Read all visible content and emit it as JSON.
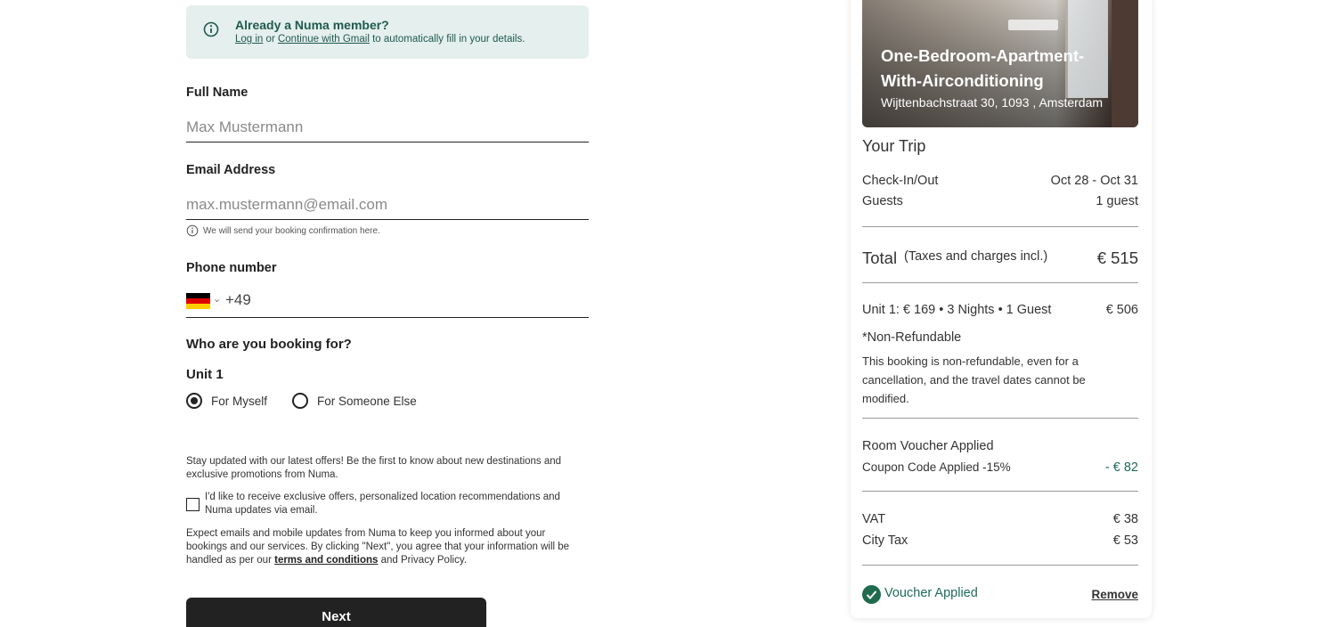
{
  "member_banner": {
    "title": "Already a Numa member?",
    "login_link": "Log in",
    "or_text": "or",
    "gmail_link": "Continue with Gmail",
    "suffix": "to automatically fill in your details."
  },
  "form": {
    "full_name_label": "Full Name",
    "full_name_placeholder": "Max Mustermann",
    "email_label": "Email Address",
    "email_placeholder": "max.mustermann@email.com",
    "email_hint": "We will send your booking confirmation here.",
    "phone_label": "Phone number",
    "phone_dial_code": "+49",
    "booking_for_question": "Who are you booking for?",
    "unit_label": "Unit 1",
    "radio_myself": "For Myself",
    "radio_someone_else": "For Someone Else",
    "selected_radio": "For Myself",
    "offers_intro": "Stay updated with our latest offers! Be the first to know about new destinations and exclusive promotions from Numa.",
    "offers_checkbox_label": "I'd like to receive exclusive offers, personalized location recommendations and Numa updates via email.",
    "legal_text_1": "Expect emails and mobile updates from Numa to keep you informed about your bookings and our services. By clicking \"Next\", you agree that your information will be handled as per our",
    "terms_link": "terms and conditions",
    "legal_text_2": "and Privacy Policy.",
    "next_button": "Next"
  },
  "summary": {
    "room_title": "One-Bedroom-Apartment-With-Airconditioning",
    "address": "Wijttenbachstraat 30, 1093 , Amsterdam",
    "your_trip": "Your Trip",
    "checkin_label": "Check-In/Out",
    "checkin_value": "Oct 28 - Oct 31",
    "guests_label": "Guests",
    "guests_value": "1 guest",
    "total_label": "Total",
    "total_note": "(Taxes and charges incl.)",
    "total_value": "€ 515",
    "unit_line": "Unit 1: € 169 • 3 Nights • 1 Guest",
    "unit_value": "€ 506",
    "refund_title": "*Non-Refundable",
    "refund_text": "This booking is non-refundable, even for a cancellation, and the travel dates cannot be modified.",
    "voucher_title": "Room Voucher Applied",
    "coupon_label": "Coupon Code Applied -15%",
    "coupon_value": "- € 82",
    "vat_label": "VAT",
    "vat_value": "€ 38",
    "city_tax_label": "City Tax",
    "city_tax_value": "€ 53",
    "voucher_applied": "Voucher Applied",
    "remove_link": "Remove"
  },
  "colors": {
    "accent_green": "#1e6b5a",
    "banner_bg": "#e5efed",
    "button_bg": "#222222"
  },
  "icons": {
    "info": "info-icon",
    "chevron": "chevron-down-icon",
    "check": "check-icon",
    "flag": "germany-flag-icon"
  }
}
